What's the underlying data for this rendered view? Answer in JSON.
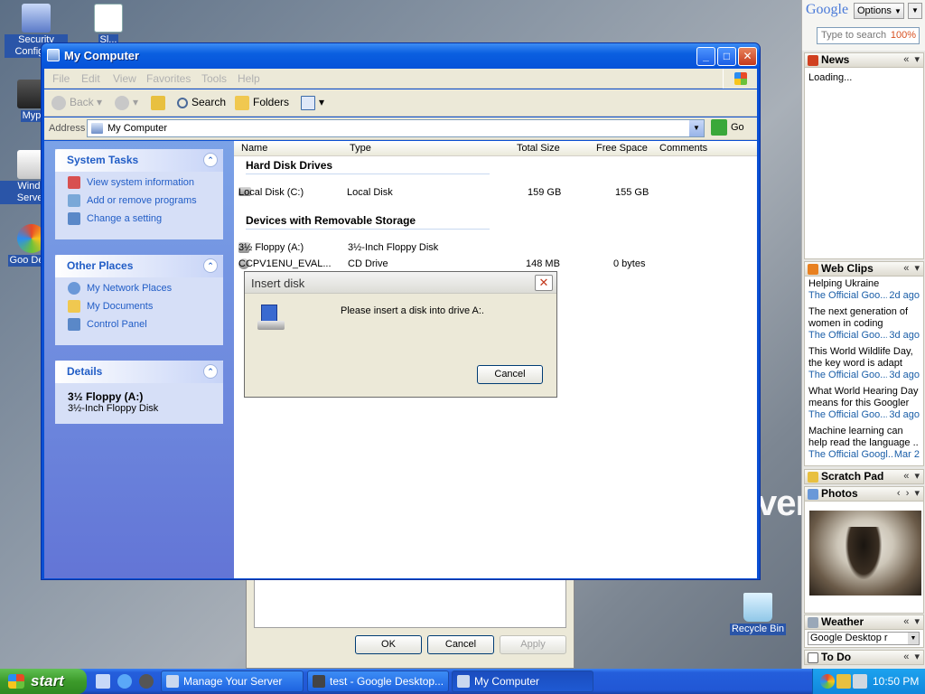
{
  "desktop": {
    "icons": [
      {
        "label": "Security Configu..."
      },
      {
        "label": "Sl..."
      },
      {
        "label": "Myp"
      },
      {
        "label": "Windo Server"
      },
      {
        "label": "Goo Desk"
      },
      {
        "label": "Recycle Bin"
      }
    ],
    "background_text": "ver"
  },
  "bg_dialog": {
    "ok": "OK",
    "cancel": "Cancel",
    "apply": "Apply"
  },
  "window": {
    "title": "My Computer",
    "menu": [
      "File",
      "Edit",
      "View",
      "Favorites",
      "Tools",
      "Help"
    ],
    "toolbar": {
      "back": "Back",
      "search": "Search",
      "folders": "Folders"
    },
    "address": {
      "label": "Address",
      "value": "My Computer",
      "go": "Go"
    },
    "tasks": {
      "system": {
        "title": "System Tasks",
        "items": [
          "View system information",
          "Add or remove programs",
          "Change a setting"
        ]
      },
      "other": {
        "title": "Other Places",
        "items": [
          "My Network Places",
          "My Documents",
          "Control Panel"
        ]
      },
      "details": {
        "title": "Details",
        "name": "3½ Floppy (A:)",
        "desc": "3½-Inch Floppy Disk"
      }
    },
    "columns": [
      "Name",
      "Type",
      "Total Size",
      "Free Space",
      "Comments"
    ],
    "groups": {
      "hdd": "Hard Disk Drives",
      "removable": "Devices with Removable Storage"
    },
    "rows": [
      {
        "name": "Local Disk (C:)",
        "type": "Local Disk",
        "total": "159 GB",
        "free": "155 GB"
      },
      {
        "name": "3½ Floppy (A:)",
        "type": "3½-Inch Floppy Disk",
        "total": "",
        "free": ""
      },
      {
        "name": "CCPV1ENU_EVAL...",
        "type": "CD Drive",
        "total": "148 MB",
        "free": "0 bytes"
      }
    ]
  },
  "modal": {
    "title": "Insert disk",
    "message": "Please insert a disk into drive A:.",
    "cancel": "Cancel"
  },
  "sidebar": {
    "logo": "Google",
    "options": "Options",
    "search_placeholder": "Type to search",
    "zoom": "100%",
    "news": {
      "title": "News",
      "status": "Loading..."
    },
    "webclips": {
      "title": "Web Clips",
      "items": [
        {
          "headline": "Helping Ukraine",
          "source": "The Official Goo...",
          "age": "2d ago"
        },
        {
          "headline": "The next generation of women in coding",
          "source": "The Official Goo...",
          "age": "3d ago"
        },
        {
          "headline": "This World Wildlife Day, the key word is adapt",
          "source": "The Official Goo...",
          "age": "3d ago"
        },
        {
          "headline": "What World Hearing Day means for this Googler",
          "source": "The Official Goo...",
          "age": "3d ago"
        },
        {
          "headline": "Machine learning can help read the language ..",
          "source": "The Official Googl...",
          "age": "Mar 2"
        }
      ]
    },
    "scratchpad": {
      "title": "Scratch Pad"
    },
    "photos": {
      "title": "Photos"
    },
    "weather": {
      "title": "Weather",
      "select": "Google Desktop r"
    },
    "todo": {
      "title": "To Do"
    }
  },
  "taskbar": {
    "start": "start",
    "items": [
      "Manage Your Server",
      "test - Google Desktop...",
      "My Computer"
    ],
    "clock": "10:50 PM"
  }
}
